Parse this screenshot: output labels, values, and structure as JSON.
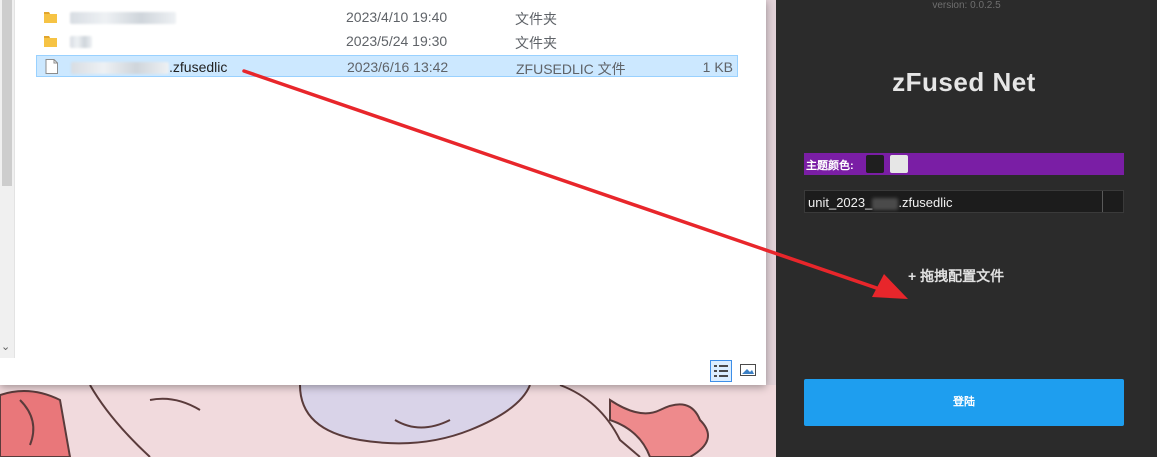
{
  "colors": {
    "panel_bg": "#2b2b2b",
    "theme_bar": "#7a1ea5",
    "login_button": "#1e9eef",
    "selection": "#cce8ff",
    "arrow": "#e8262b"
  },
  "explorer": {
    "files": [
      {
        "icon": "folder-icon",
        "name_suffix": "",
        "date": "2023/4/10 19:40",
        "type": "文件夹",
        "size": ""
      },
      {
        "icon": "folder-icon",
        "name_suffix": "",
        "date": "2023/5/24 19:30",
        "type": "文件夹",
        "size": ""
      },
      {
        "icon": "file-icon",
        "name_suffix": ".zfusedlic",
        "date": "2023/6/16 13:42",
        "type": "ZFUSEDLIC 文件",
        "size": "1 KB",
        "selected": true
      }
    ],
    "nav_chevron": "⌄"
  },
  "app": {
    "version": "version: 0.0.2.5",
    "title": "zFused Net",
    "theme_label": "主题颜色:",
    "file_prefix": "unit_2023_",
    "file_suffix": ".zfusedlic",
    "drag_hint": "+ 拖拽配置文件",
    "login_label": "登陆"
  }
}
